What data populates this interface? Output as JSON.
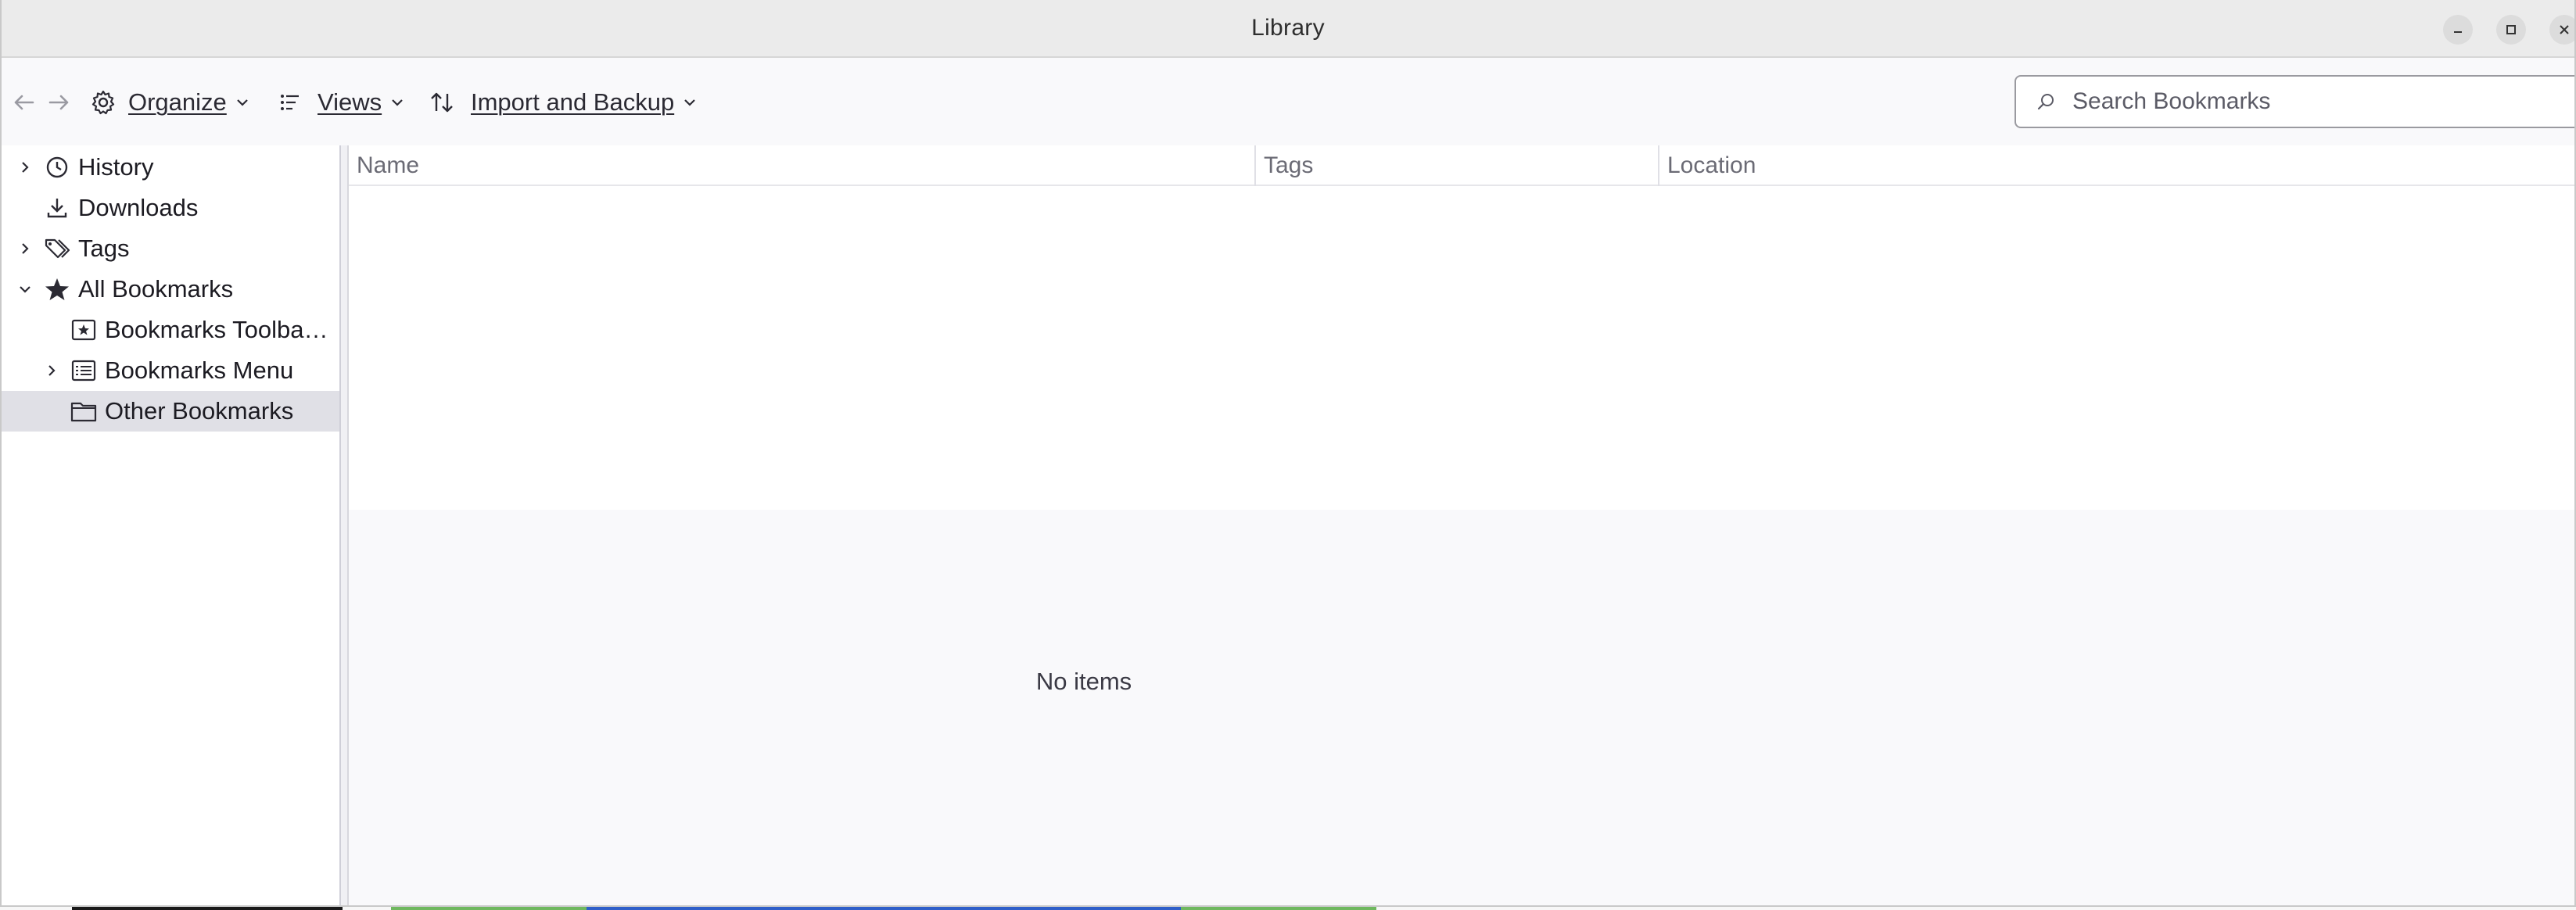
{
  "window": {
    "title": "Library",
    "controls": [
      "minimize",
      "maximize",
      "close"
    ]
  },
  "toolbar": {
    "back_icon": "arrow-left-icon",
    "forward_icon": "arrow-right-icon",
    "organize_label": "Organize",
    "views_label": "Views",
    "import_label": "Import and Backup",
    "search_placeholder": "Search Bookmarks"
  },
  "sidebar": {
    "items": [
      {
        "label": "History",
        "icon": "clock-icon",
        "expandable": true,
        "expanded": false
      },
      {
        "label": "Downloads",
        "icon": "download-icon",
        "expandable": false
      },
      {
        "label": "Tags",
        "icon": "tag-icon",
        "expandable": true,
        "expanded": false
      },
      {
        "label": "All Bookmarks",
        "icon": "star-icon",
        "expandable": true,
        "expanded": true
      },
      {
        "label": "Bookmarks Toolba…",
        "icon": "bookmarks-toolbar-icon",
        "expandable": false
      },
      {
        "label": "Bookmarks Menu",
        "icon": "bookmarks-menu-icon",
        "expandable": true,
        "expanded": false
      },
      {
        "label": "Other Bookmarks",
        "icon": "folder-icon",
        "expandable": false,
        "selected": true
      }
    ]
  },
  "table": {
    "columns": [
      "Name",
      "Tags",
      "Location"
    ],
    "rows": []
  },
  "details": {
    "empty_text": "No items"
  },
  "colors": {
    "selected_row": "#e0e0e6",
    "titlebar": "#ebebeb",
    "window_bg": "#f9f9fb"
  }
}
